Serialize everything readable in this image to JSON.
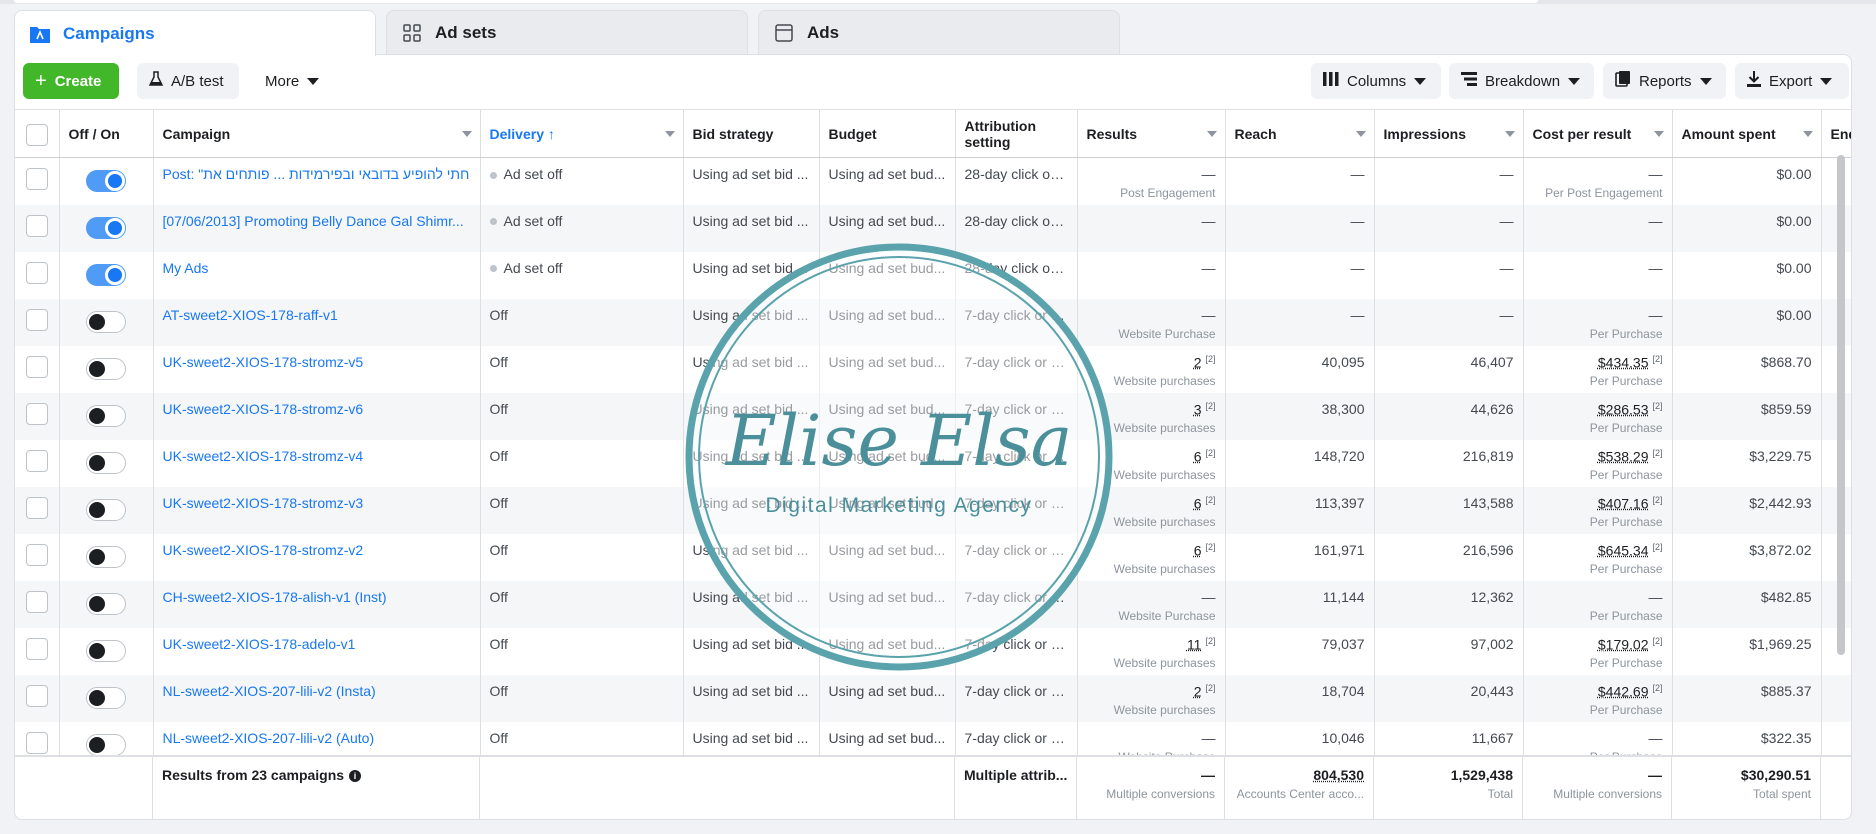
{
  "tabs": [
    {
      "label": "Campaigns",
      "icon": "folder-icon"
    },
    {
      "label": "Ad sets",
      "icon": "grid-icon"
    },
    {
      "label": "Ads",
      "icon": "ad-window-icon"
    }
  ],
  "toolbar": {
    "create": "Create",
    "ab_test": "A/B test",
    "more": "More",
    "columns": "Columns",
    "breakdown": "Breakdown",
    "reports": "Reports",
    "export": "Export"
  },
  "columns": [
    "Off / On",
    "Campaign",
    "Delivery ↑",
    "Bid strategy",
    "Budget",
    "Attribution setting",
    "Results",
    "Reach",
    "Impressions",
    "Cost per result",
    "Amount spent",
    "End"
  ],
  "rows": [
    {
      "on": true,
      "name": "Post: \"חתי להופיע בדובאי ובפירמידות ... פותחים את",
      "delivery": "Ad set off",
      "bid": "Using ad set bid ...",
      "budget": "Using ad set bud...",
      "attr": "28-day click or ...",
      "results": "—",
      "results_sub": "Post Engagement",
      "results_sup": "",
      "reach": "—",
      "impressions": "—",
      "cpr": "—",
      "cpr_sub": "Per Post Engagement",
      "cpr_sup": "",
      "spent": "$0.00"
    },
    {
      "on": true,
      "name": "[07/06/2013] Promoting Belly Dance Gal Shimr...",
      "delivery": "Ad set off",
      "bid": "Using ad set bid ...",
      "budget": "Using ad set bud...",
      "attr": "28-day click or ...",
      "results": "—",
      "results_sub": "",
      "results_sup": "",
      "reach": "—",
      "impressions": "—",
      "cpr": "—",
      "cpr_sub": "",
      "cpr_sup": "",
      "spent": "$0.00"
    },
    {
      "on": true,
      "name": "My Ads",
      "delivery": "Ad set off",
      "bid": "Using ad set bid ...",
      "budget": "Using ad set bud...",
      "attr": "28-day click or ...",
      "results": "—",
      "results_sub": "",
      "results_sup": "",
      "reach": "—",
      "impressions": "—",
      "cpr": "—",
      "cpr_sub": "",
      "cpr_sup": "",
      "spent": "$0.00"
    },
    {
      "on": false,
      "name": "AT-sweet2-XIOS-178-raff-v1",
      "delivery": "Off",
      "bid": "Using ad set bid ...",
      "budget": "Using ad set bud...",
      "attr": "7-day click or 1...",
      "results": "—",
      "results_sub": "Website Purchase",
      "results_sup": "",
      "reach": "—",
      "impressions": "—",
      "cpr": "—",
      "cpr_sub": "Per Purchase",
      "cpr_sup": "",
      "spent": "$0.00"
    },
    {
      "on": false,
      "name": "UK-sweet2-XIOS-178-stromz-v5",
      "delivery": "Off",
      "bid": "Using ad set bid ...",
      "budget": "Using ad set bud...",
      "attr": "7-day click or 1...",
      "results": "2",
      "results_sub": "Website purchases",
      "results_sup": "[2]",
      "reach": "40,095",
      "impressions": "46,407",
      "cpr": "$434.35",
      "cpr_sub": "Per Purchase",
      "cpr_sup": "[2]",
      "spent": "$868.70"
    },
    {
      "on": false,
      "name": "UK-sweet2-XIOS-178-stromz-v6",
      "delivery": "Off",
      "bid": "Using ad set bid ...",
      "budget": "Using ad set bud...",
      "attr": "7-day click or 1...",
      "results": "3",
      "results_sub": "Website purchases",
      "results_sup": "[2]",
      "reach": "38,300",
      "impressions": "44,626",
      "cpr": "$286.53",
      "cpr_sub": "Per Purchase",
      "cpr_sup": "[2]",
      "spent": "$859.59"
    },
    {
      "on": false,
      "name": "UK-sweet2-XIOS-178-stromz-v4",
      "delivery": "Off",
      "bid": "Using ad set bid ...",
      "budget": "Using ad set bud...",
      "attr": "7-day click or 1...",
      "results": "6",
      "results_sub": "Website purchases",
      "results_sup": "[2]",
      "reach": "148,720",
      "impressions": "216,819",
      "cpr": "$538.29",
      "cpr_sub": "Per Purchase",
      "cpr_sup": "[2]",
      "spent": "$3,229.75"
    },
    {
      "on": false,
      "name": "UK-sweet2-XIOS-178-stromz-v3",
      "delivery": "Off",
      "bid": "Using ad set bid ...",
      "budget": "Using ad set bud...",
      "attr": "7-day click or 1...",
      "results": "6",
      "results_sub": "Website purchases",
      "results_sup": "[2]",
      "reach": "113,397",
      "impressions": "143,588",
      "cpr": "$407.16",
      "cpr_sub": "Per Purchase",
      "cpr_sup": "[2]",
      "spent": "$2,442.93"
    },
    {
      "on": false,
      "name": "UK-sweet2-XIOS-178-stromz-v2",
      "delivery": "Off",
      "bid": "Using ad set bid ...",
      "budget": "Using ad set bud...",
      "attr": "7-day click or 1...",
      "results": "6",
      "results_sub": "Website purchases",
      "results_sup": "[2]",
      "reach": "161,971",
      "impressions": "216,596",
      "cpr": "$645.34",
      "cpr_sub": "Per Purchase",
      "cpr_sup": "[2]",
      "spent": "$3,872.02"
    },
    {
      "on": false,
      "name": "CH-sweet2-XIOS-178-alish-v1 (Inst)",
      "delivery": "Off",
      "bid": "Using ad set bid ...",
      "budget": "Using ad set bud...",
      "attr": "7-day click or 1...",
      "results": "—",
      "results_sub": "Website Purchase",
      "results_sup": "",
      "reach": "11,144",
      "impressions": "12,362",
      "cpr": "—",
      "cpr_sub": "Per Purchase",
      "cpr_sup": "",
      "spent": "$482.85"
    },
    {
      "on": false,
      "name": "UK-sweet2-XIOS-178-adelo-v1",
      "delivery": "Off",
      "bid": "Using ad set bid ...",
      "budget": "Using ad set bud...",
      "attr": "7-day click or 1...",
      "results": "11",
      "results_sub": "Website purchases",
      "results_sup": "[2]",
      "reach": "79,037",
      "impressions": "97,002",
      "cpr": "$179.02",
      "cpr_sub": "Per Purchase",
      "cpr_sup": "[2]",
      "spent": "$1,969.25"
    },
    {
      "on": false,
      "name": "NL-sweet2-XIOS-207-lili-v2 (Insta)",
      "delivery": "Off",
      "bid": "Using ad set bid ...",
      "budget": "Using ad set bud...",
      "attr": "7-day click or 1...",
      "results": "2",
      "results_sub": "Website purchases",
      "results_sup": "[2]",
      "reach": "18,704",
      "impressions": "20,443",
      "cpr": "$442.69",
      "cpr_sub": "Per Purchase",
      "cpr_sup": "[2]",
      "spent": "$885.37"
    },
    {
      "on": false,
      "name": "NL-sweet2-XIOS-207-lili-v2 (Auto)",
      "delivery": "Off",
      "bid": "Using ad set bid ...",
      "budget": "Using ad set bud...",
      "attr": "7-day click or 1...",
      "results": "—",
      "results_sub": "Website Purchase",
      "results_sup": "",
      "reach": "10,046",
      "impressions": "11,667",
      "cpr": "—",
      "cpr_sub": "Per Purchase",
      "cpr_sup": "",
      "spent": "$322.35"
    }
  ],
  "footer": {
    "label": "Results from 23 campaigns",
    "attribution": "Multiple attrib...",
    "results": "—",
    "results_sub": "Multiple conversions",
    "reach": "804,530",
    "reach_sub": "Accounts Center acco...",
    "impressions": "1,529,438",
    "impressions_sub": "Total",
    "cpr": "—",
    "cpr_sub": "Multiple conversions",
    "spent": "$30,290.51",
    "spent_sub": "Total spent"
  },
  "watermark": {
    "title": "Elise Elsa",
    "subtitle": "Digital Marketing Agency"
  },
  "colors": {
    "accent": "#1877f2",
    "create": "#42b72a",
    "watermark": "#4a8f9a"
  }
}
